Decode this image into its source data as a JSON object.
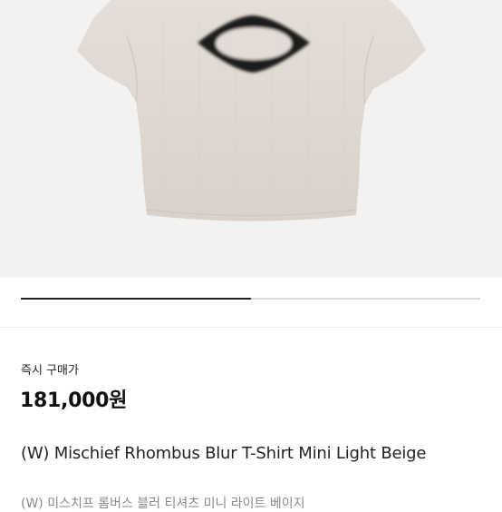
{
  "product": {
    "image_alt": "Light beige cropped T-shirt with black blurred rhombus graphic",
    "carousel": {
      "progress": 0.5
    },
    "price_label": "즉시 구매가",
    "price": "181,000원",
    "title": "(W) Mischief Rhombus Blur T-Shirt Mini Light Beige",
    "subtitle_ko": "(W) 미스치프 롬버스 블러 티셔츠 미니 라이트 베이지"
  },
  "colors": {
    "shirt": "#e1dbd4",
    "graphic": "#1f1b1a",
    "background": "#f3f2f0"
  }
}
